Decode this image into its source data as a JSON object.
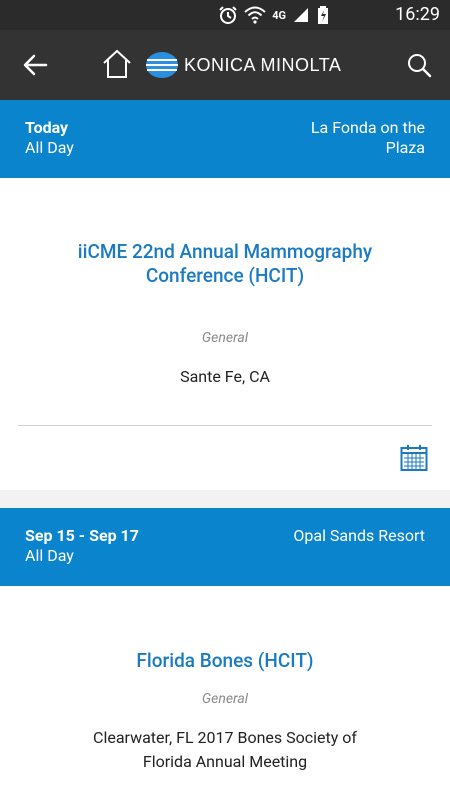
{
  "status_bar": {
    "time": "16:29",
    "network": "4G"
  },
  "app_bar": {
    "back_icon": "arrow-left-icon",
    "home_icon": "home-icon",
    "brand": "KONICA MINOLTA",
    "search_icon": "search-icon"
  },
  "colors": {
    "accent": "#0a84cc",
    "title": "#1a7bc2",
    "app_bar": "#333333"
  },
  "events": [
    {
      "date": "Today",
      "time": "All Day",
      "venue": "La Fonda on the Plaza",
      "title": "iiCME 22nd Annual Mammography Conference (HCIT)",
      "category": "General",
      "location": "Sante Fe, CA",
      "calendar_icon": "calendar-icon"
    },
    {
      "date": "Sep 15 - Sep 17",
      "time": "All Day",
      "venue": "Opal Sands Resort",
      "title": "Florida Bones (HCIT)",
      "category": "General",
      "location": "Clearwater, FL 2017 Bones Society of Florida Annual Meeting"
    }
  ]
}
